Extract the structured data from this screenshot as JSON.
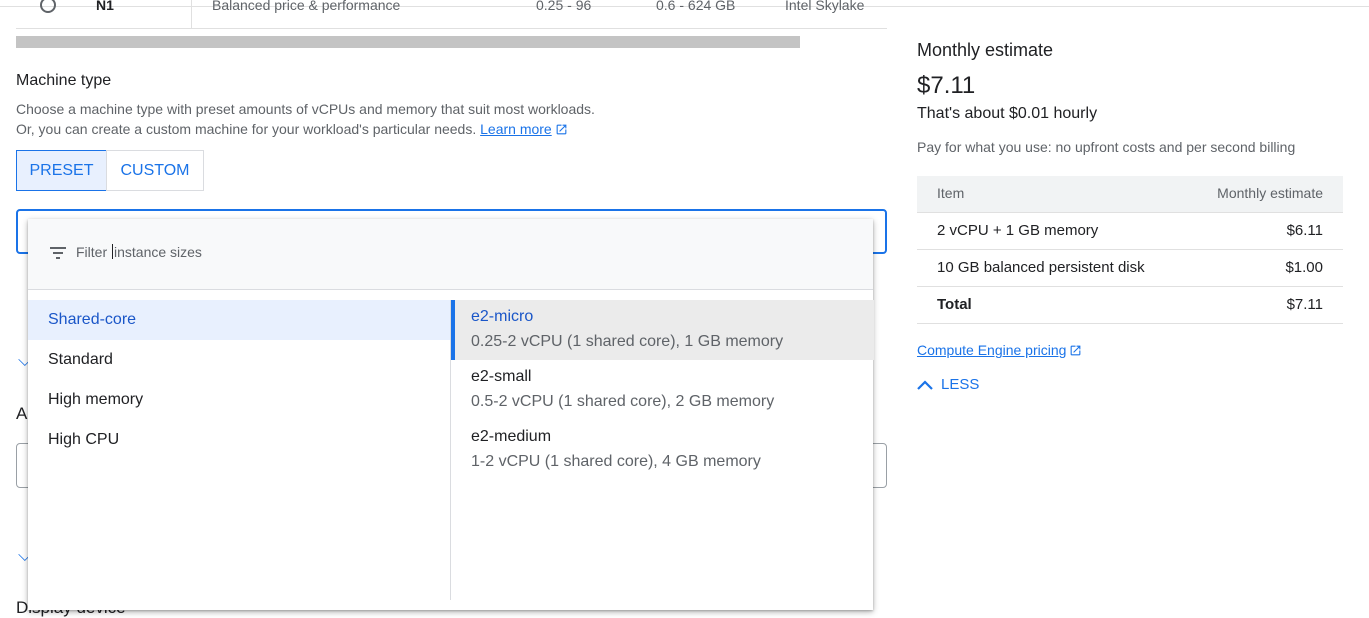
{
  "top_row": {
    "name": "N1",
    "description": "Balanced price & performance",
    "vcpus": "0.25 - 96",
    "memory": "0.6 - 624 GB",
    "platform": "Intel Skylake"
  },
  "machine_type": {
    "title": "Machine type",
    "desc_line1": "Choose a machine type with preset amounts of vCPUs and memory that suit most workloads.",
    "desc_line2": "Or, you can create a custom machine for your workload's particular needs.",
    "learn_more": "Learn more",
    "preset_label": "PRESET",
    "custom_label": "CUSTOM"
  },
  "background": {
    "partial_heading": "A",
    "display_device": "Display device"
  },
  "dropdown": {
    "filter_before_caret": "Filter ",
    "filter_after_caret": "instance sizes",
    "categories": [
      "Shared-core",
      "Standard",
      "High memory",
      "High CPU"
    ],
    "selected_category": "Shared-core",
    "options": [
      {
        "name": "e2-micro",
        "desc": "0.25-2 vCPU (1 shared core), 1 GB memory"
      },
      {
        "name": "e2-small",
        "desc": "0.5-2 vCPU (1 shared core), 2 GB memory"
      },
      {
        "name": "e2-medium",
        "desc": "1-2 vCPU (1 shared core), 4 GB memory"
      }
    ],
    "selected_option": "e2-micro"
  },
  "estimate": {
    "title": "Monthly estimate",
    "price": "$7.11",
    "hourly": "That's about $0.01 hourly",
    "payg": "Pay for what you use: no upfront costs and per second billing",
    "table_header": {
      "item": "Item",
      "estimate": "Monthly estimate"
    },
    "rows": [
      {
        "item": "2 vCPU + 1 GB memory",
        "cost": "$6.11"
      },
      {
        "item": "10 GB balanced persistent disk",
        "cost": "$1.00"
      },
      {
        "item": "Total",
        "cost": "$7.11"
      }
    ],
    "pricing_link": "Compute Engine pricing",
    "less_label": "LESS"
  },
  "colors": {
    "accent": "#1a73e8",
    "selected_bg": "#e8f0fe"
  }
}
